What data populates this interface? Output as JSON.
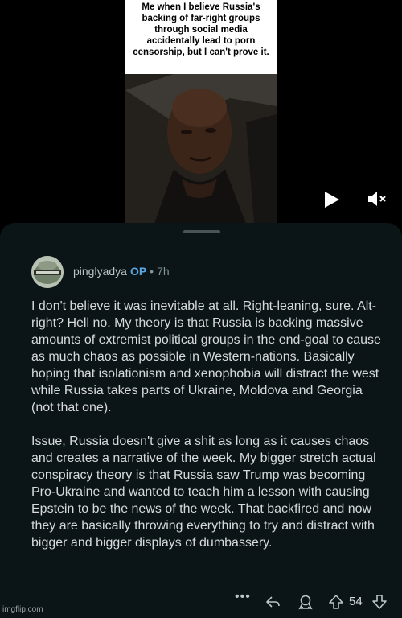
{
  "meme": {
    "caption_lines": [
      "Me when I believe Russia's",
      "backing of far-right groups",
      "through social media",
      "accidentally lead to porn",
      "censorship, but I can't prove it."
    ]
  },
  "video_controls": {
    "play_icon": "play-icon",
    "mute_icon": "volume-muted-icon"
  },
  "comment": {
    "username": "pinglyadya",
    "op_badge": "OP",
    "separator": "•",
    "time": "7h",
    "paragraphs": [
      "I don't believe it was inevitable at all. Right-leaning, sure. Alt-right? Hell no. My theory is that Russia is backing massive amounts of extremist political groups in the end-goal to cause as much chaos as possible in Western-nations. Basically hoping that isolationism and xenophobia will distract the west while Russia takes parts of Ukraine, Moldova and Georgia (not that one).",
      "Issue, Russia doesn't give a shit as long as it causes chaos and creates a narrative of the week. My bigger stretch actual conspiracy theory is that Russia saw Trump was becoming Pro-Ukraine and wanted to teach him a lesson with causing Epstein to be the news of the week. That backfired and now they are basically throwing everything to try and distract with bigger and bigger displays of dumbassery."
    ],
    "actions": {
      "more": "•••",
      "score": "54"
    }
  },
  "watermark": "imgflip.com",
  "colors": {
    "op_accent": "#5aa9e6",
    "sheet_bg": "#0b1416",
    "text": "#d7dadc"
  }
}
